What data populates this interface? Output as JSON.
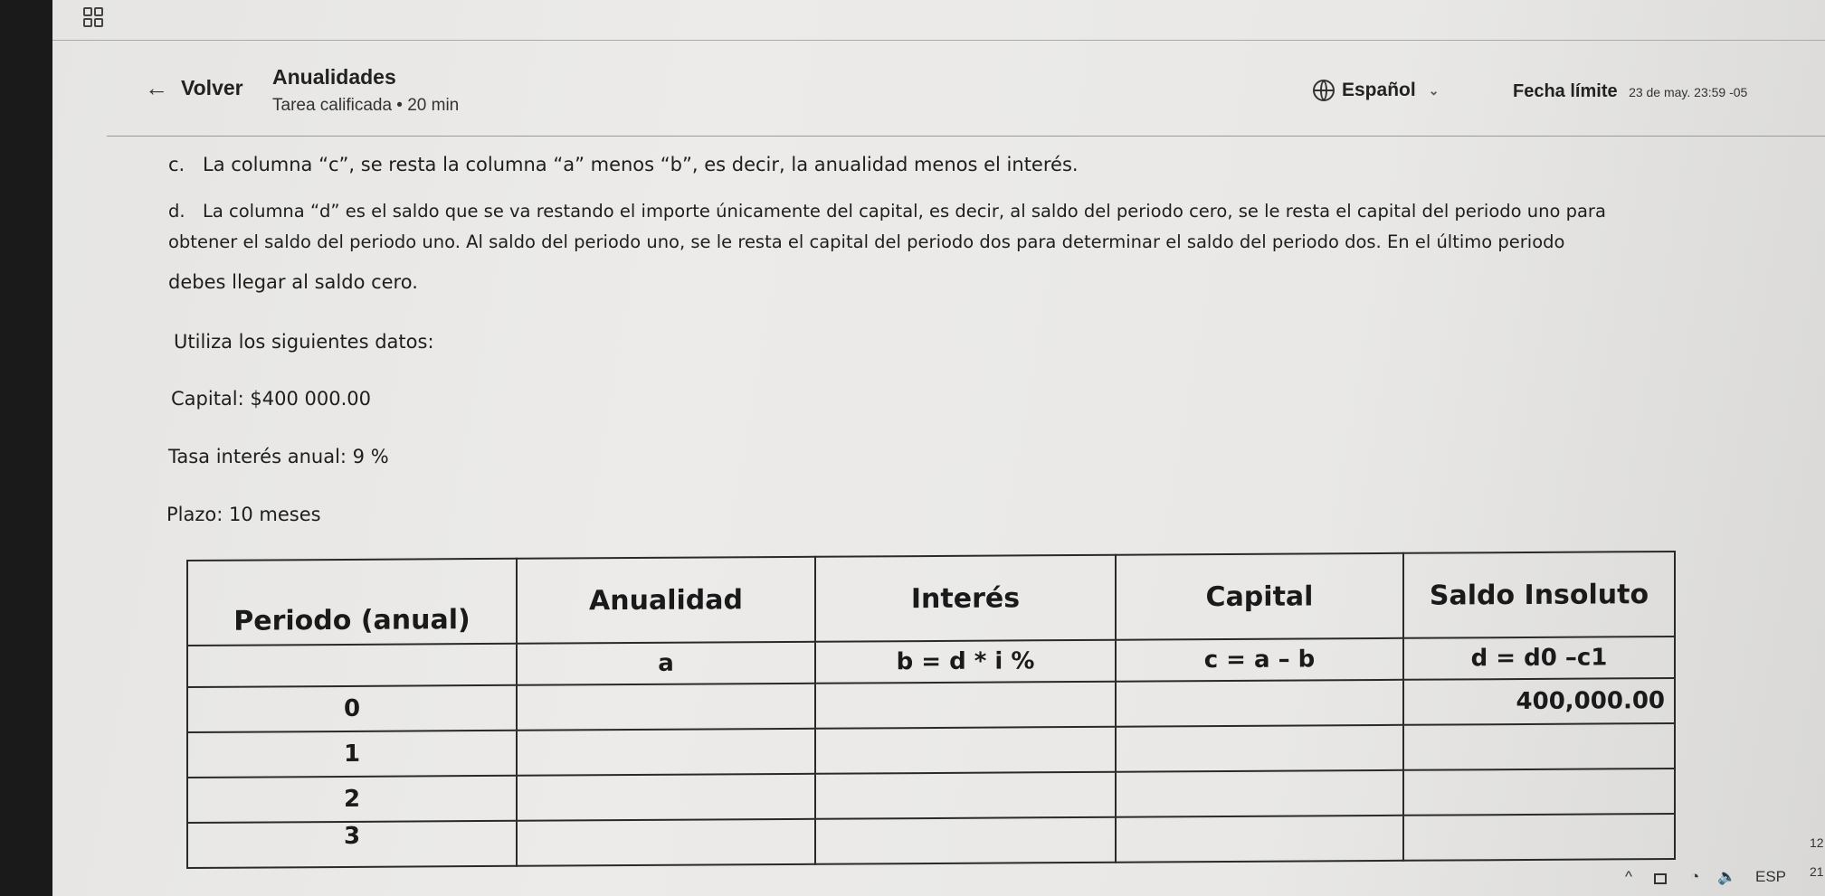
{
  "header": {
    "back_label": "Volver",
    "title": "Anualidades",
    "subtitle": "Tarea calificada • 20 min",
    "language": "Español",
    "deadline_label": "Fecha límite",
    "deadline_value": "23 de may. 23:59 -05"
  },
  "body": {
    "item_c_letter": "c.",
    "item_c": "La columna “c”, se resta la columna “a” menos “b”, es decir, la anualidad menos el interés.",
    "item_d_letter": "d.",
    "item_d_line1": "La columna “d” es el saldo que se va restando el importe únicamente del capital, es decir, al saldo del periodo cero, se le resta el capital del periodo uno para",
    "item_d_line2": "obtener el saldo del periodo uno. Al saldo del periodo uno, se le resta el capital del periodo dos para determinar el saldo del periodo dos. En el último periodo",
    "item_d_line3": "debes llegar al saldo cero.",
    "data_intro": "Utiliza los siguientes datos:",
    "capital": "Capital: $400 000.00",
    "rate": "Tasa interés anual: 9 %",
    "term": "Plazo: 10 meses"
  },
  "table": {
    "headers": [
      "Periodo (anual)",
      "Anualidad",
      "Interés",
      "Capital",
      "Saldo Insoluto"
    ],
    "formulas": [
      "",
      "a",
      "b = d * i %",
      "c = a – b",
      "d = d0 –c1"
    ],
    "initial_balance": "400,000.00",
    "periods": [
      "0",
      "1",
      "2",
      "3"
    ]
  },
  "taskbar": {
    "lang": "ESP",
    "time_partial": "12",
    "date_partial": "21"
  }
}
